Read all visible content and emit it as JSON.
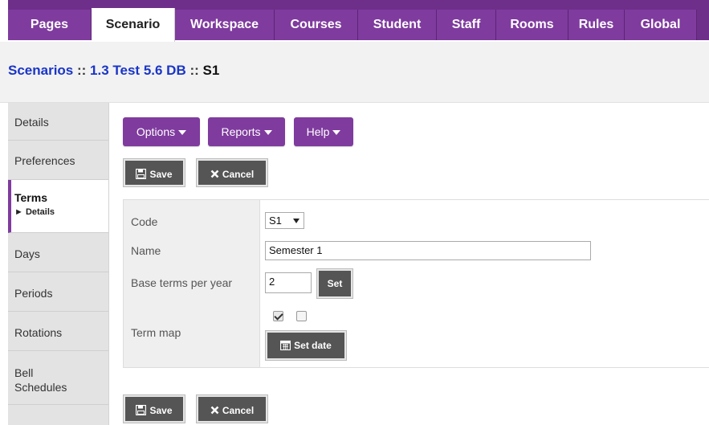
{
  "tabs": [
    {
      "label": "Pages"
    },
    {
      "label": "Scenario"
    },
    {
      "label": "Workspace"
    },
    {
      "label": "Courses"
    },
    {
      "label": "Student"
    },
    {
      "label": "Staff"
    },
    {
      "label": "Rooms"
    },
    {
      "label": "Rules"
    },
    {
      "label": "Global"
    }
  ],
  "breadcrumb": {
    "part1": "Scenarios",
    "sep1": " :: ",
    "part2": "1.3 Test 5.6 DB",
    "sep2": " :: ",
    "current": "S1"
  },
  "sidebar": {
    "items": [
      {
        "label": "Details"
      },
      {
        "label": "Preferences"
      },
      {
        "label": "Terms",
        "sub": "► Details"
      },
      {
        "label": "Days"
      },
      {
        "label": "Periods"
      },
      {
        "label": "Rotations"
      },
      {
        "label": "Bell Schedules"
      }
    ]
  },
  "toolbar": {
    "options_label": "Options",
    "reports_label": "Reports",
    "help_label": "Help",
    "save_label": "Save",
    "cancel_label": "Cancel"
  },
  "form": {
    "code_label": "Code",
    "code_value": "S1",
    "name_label": "Name",
    "name_value": "Semester 1",
    "base_terms_label": "Base terms per year",
    "base_terms_value": "2",
    "set_label": "Set",
    "term_map_label": "Term map",
    "term_map_checks": [
      true,
      false
    ],
    "set_date_label": "Set date"
  },
  "colors": {
    "accent": "#7f3b9e",
    "link": "#1a35c7",
    "button_dark": "#555555"
  }
}
